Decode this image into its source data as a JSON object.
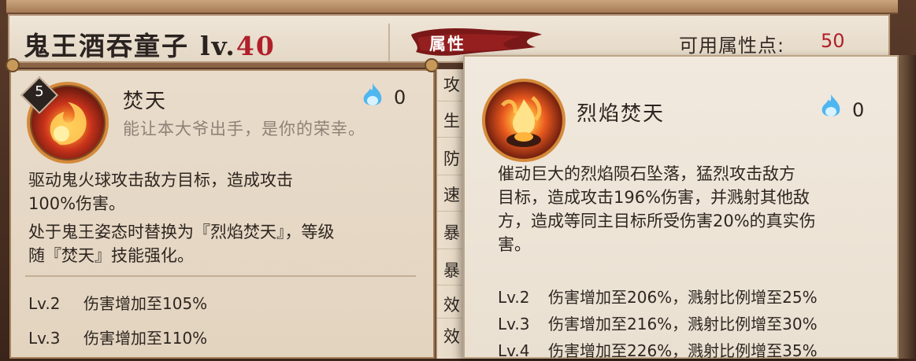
{
  "header": {
    "hero_name": "鬼王酒吞童子",
    "level_prefix": "lv.",
    "level_value": "40",
    "attr_tab": "属性",
    "points_label": "可用属性点:",
    "points_value": "50"
  },
  "left_skill": {
    "level_badge": "5",
    "name": "焚天",
    "quote": "能让本大爷出手，是你的荣幸。",
    "cost": "0",
    "icon": "fire-orb-icon",
    "description_lines": [
      "驱动鬼火球攻击敌方目标，造成攻击",
      "100%伤害。",
      "处于鬼王姿态时替换为『烈焰焚天』，等级",
      "随『焚天』技能强化。"
    ],
    "upgrades": [
      {
        "lv": "Lv.2",
        "text": "伤害增加至105%"
      },
      {
        "lv": "Lv.3",
        "text": "伤害增加至110%"
      }
    ]
  },
  "attributes_column": [
    "攻",
    "生",
    "防",
    "速",
    "暴",
    "暴",
    "效",
    "效"
  ],
  "right_skill": {
    "name": "烈焰焚天",
    "cost": "0",
    "icon": "flaming-meteor-icon",
    "description_lines": [
      "催动巨大的烈焰陨石坠落，猛烈攻击敌方",
      "目标，造成攻击196%伤害，并溅射其他敌",
      "方，造成等同主目标所受伤害20%的真实伤",
      "害。"
    ],
    "upgrades": [
      {
        "lv": "Lv.2",
        "text": "伤害增加至206%，溅射比例增至25%"
      },
      {
        "lv": "Lv.3",
        "text": "伤害增加至216%，溅射比例增至30%"
      },
      {
        "lv": "Lv.4",
        "text": "伤害增加至226%，溅射比例增至35%"
      }
    ]
  },
  "colors": {
    "level_red": "#b0202a",
    "parchment": "#e9dccb",
    "frame_brown": "#5a3b2a",
    "orb_blue": "#4fb6f0"
  }
}
